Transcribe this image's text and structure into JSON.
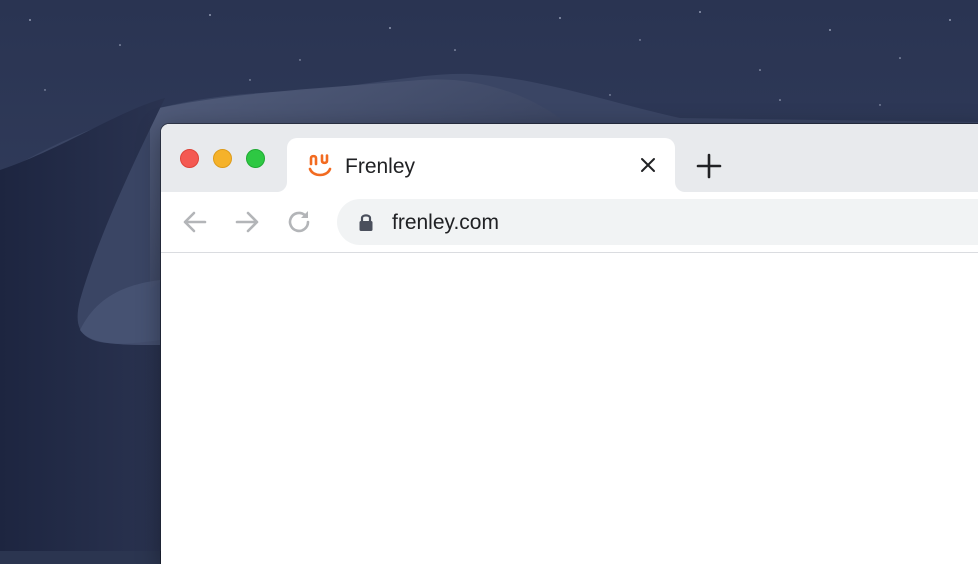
{
  "desktop": {
    "wallpaper": "night desert dunes",
    "sky_color": "#2e3a5a",
    "dune_color": "#1f2742"
  },
  "window_controls": {
    "close_color": "#f45952",
    "minimize_color": "#f5b22a",
    "zoom_color": "#2ec843"
  },
  "tab": {
    "title": "Frenley",
    "favicon": "frenley-logo-icon",
    "favicon_color": "#f26b21",
    "close_icon": "close-icon"
  },
  "new_tab": {
    "icon": "plus-icon"
  },
  "toolbar": {
    "back_icon": "arrow-left-icon",
    "forward_icon": "arrow-right-icon",
    "reload_icon": "reload-icon"
  },
  "address_bar": {
    "secure_icon": "lock-icon",
    "url": "frenley.com"
  }
}
